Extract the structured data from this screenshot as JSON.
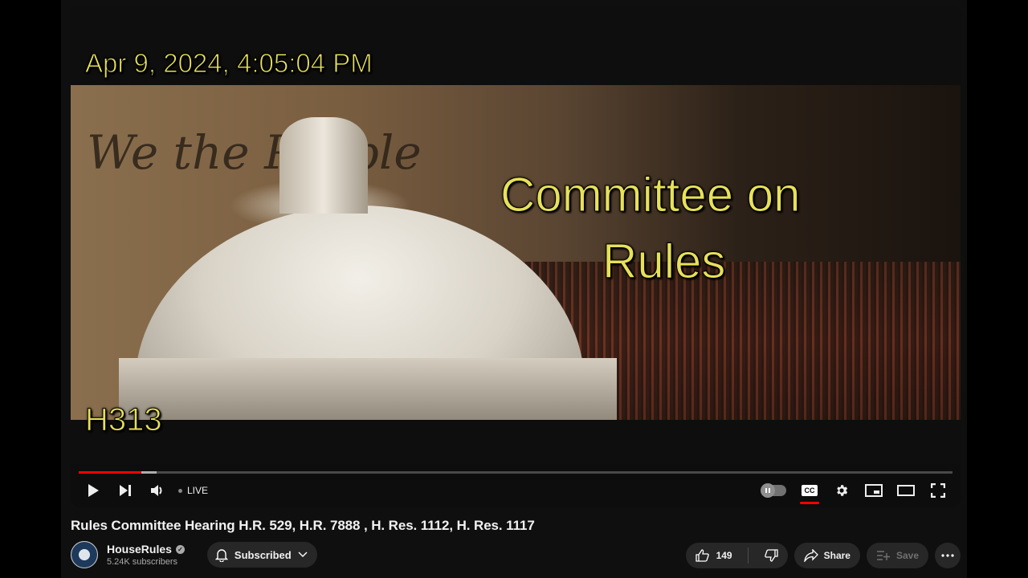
{
  "video": {
    "overlay_timestamp": "Apr 9, 2024, 4:05:04 PM",
    "overlay_title_line1": "Committee on",
    "overlay_title_line2": "Rules",
    "overlay_script": "We the People",
    "overlay_room": "H313",
    "progress": {
      "played_fraction": 0.072,
      "buffered_fraction": 0.089,
      "played_color": "#ff0000"
    }
  },
  "controls": {
    "play_icon": "play-icon",
    "next_icon": "skip-next-icon",
    "volume_icon": "volume-icon",
    "live_label": "LIVE",
    "autoplay_icon": "autoplay-toggle-icon",
    "cc_label": "CC",
    "settings_icon": "gear-icon",
    "miniplayer_icon": "miniplayer-icon",
    "theater_icon": "theater-mode-icon",
    "fullscreen_icon": "fullscreen-icon"
  },
  "title": "Rules Committee Hearing H.R. 529, H.R. 7888 , H. Res. 1112, H. Res. 1117",
  "channel": {
    "name": "HouseRules",
    "verified": true,
    "subscribers": "5.24K subscribers",
    "subscribe_label": "Subscribed"
  },
  "actions": {
    "likes": "149",
    "share_label": "Share",
    "save_label": "Save",
    "more_icon": "more-horizontal-icon"
  }
}
